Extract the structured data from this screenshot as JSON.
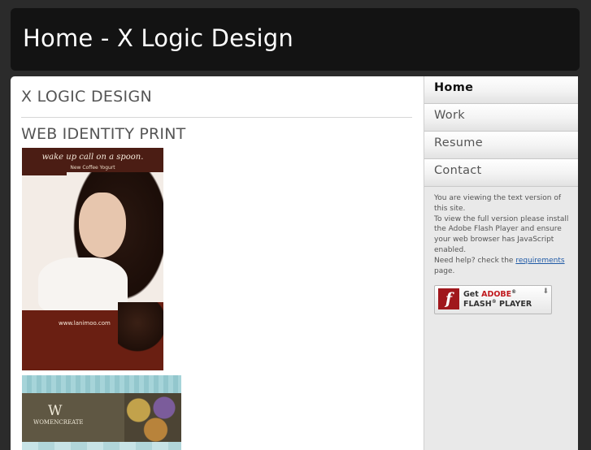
{
  "header": {
    "title": "Home - X Logic Design"
  },
  "main": {
    "site_name": "X LOGIC DESIGN",
    "section_title": "WEB IDENTITY PRINT",
    "portfolio": [
      {
        "tagline": "wake up call on a spoon.",
        "subtag": "New Coffee Yogurt",
        "url": "www.lanimoo.com"
      },
      {
        "logo_mark": "W",
        "logo_text": "WOMENCREATE"
      }
    ]
  },
  "sidebar": {
    "nav": [
      {
        "label": "Home",
        "active": true
      },
      {
        "label": "Work",
        "active": false
      },
      {
        "label": "Resume",
        "active": false
      },
      {
        "label": "Contact",
        "active": false
      }
    ],
    "info": {
      "line1": "You are viewing the text version of this site.",
      "line2": "To view the full version please install the Adobe Flash Player and ensure your web browser has JavaScript enabled.",
      "line3_prefix": "Need help? check the ",
      "line3_link": "requirements",
      "line3_suffix": " page."
    },
    "flash_button": {
      "get": "Get ",
      "brand": "ADOBE",
      "player": "FLASH",
      "player_suffix": "PLAYER",
      "icon_glyph": "f"
    }
  },
  "colors": {
    "background": "#2b2b2b",
    "header": "#131313",
    "link": "#1f5aa6",
    "flash_red": "#a0171c"
  }
}
